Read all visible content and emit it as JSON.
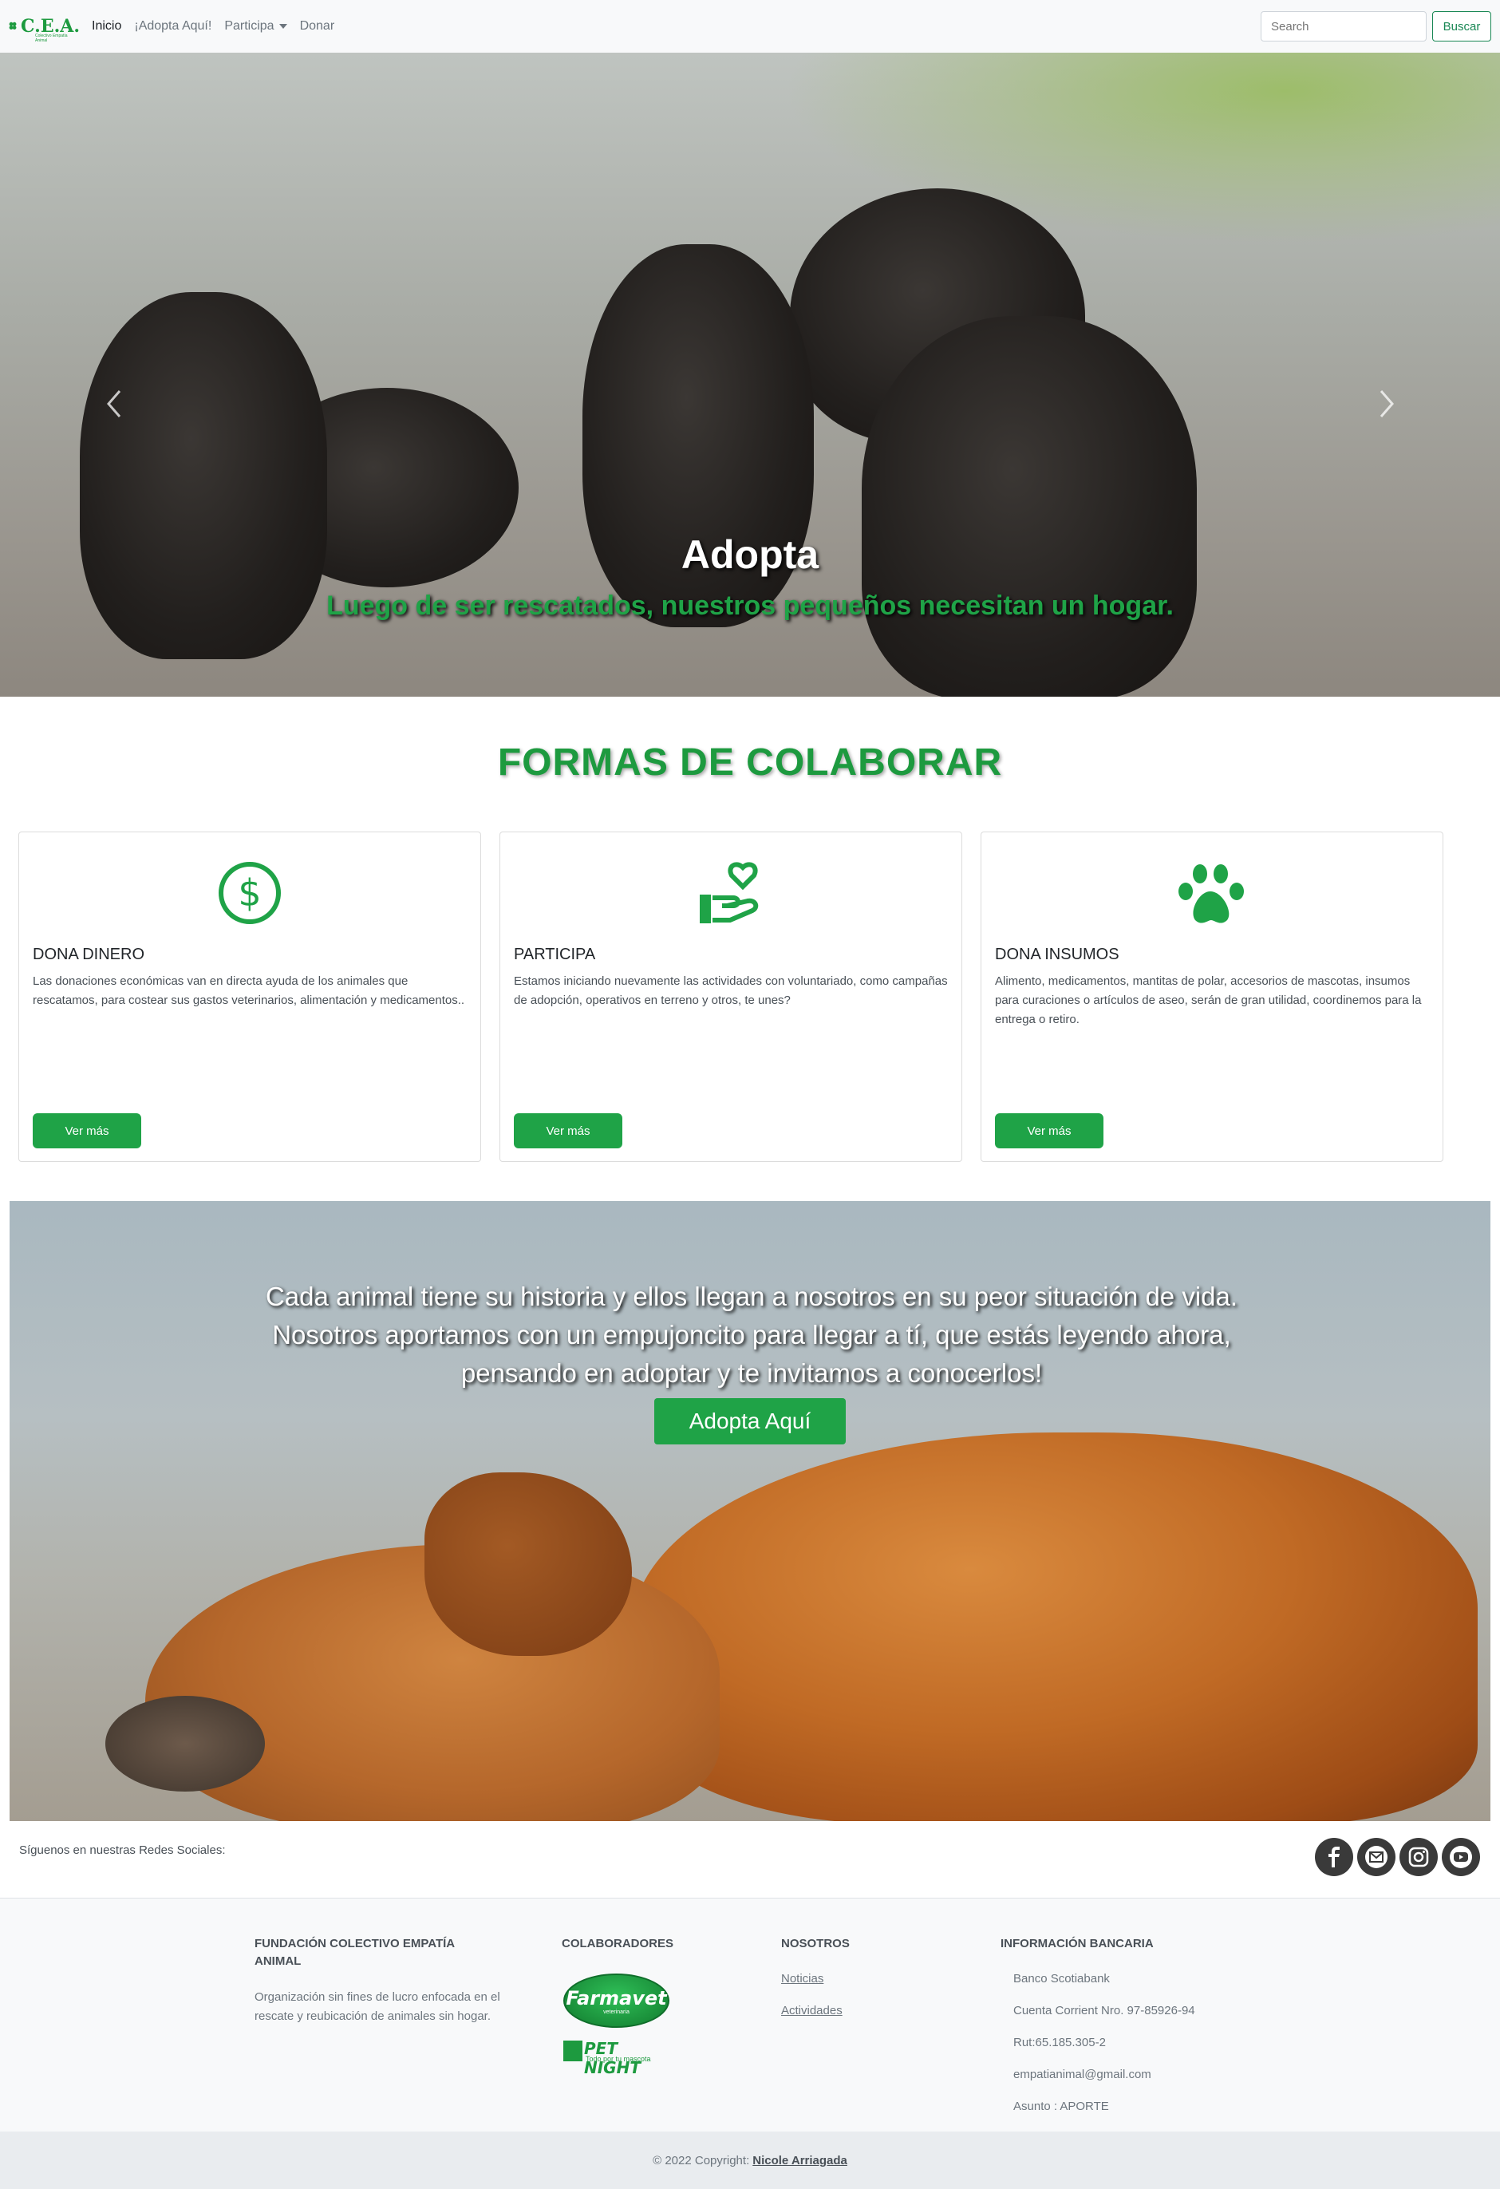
{
  "nav": {
    "logo_text": "C.E.A.",
    "logo_sub": "Colectivo Empatía Animal",
    "links": [
      "Inicio",
      "¡Adopta Aquí!",
      "Participa",
      "Donar"
    ],
    "search_placeholder": "Search",
    "search_button": "Buscar"
  },
  "hero": {
    "title": "Adopta",
    "subtitle": "Luego de ser rescatados, nuestros pequeños necesitan un hogar.",
    "prev_icon": "chevron-left-icon",
    "next_icon": "chevron-right-icon",
    "slides": 3,
    "active_slide": 1
  },
  "section": {
    "title": "FORMAS DE COLABORAR"
  },
  "cards": [
    {
      "icon": "dollar-circle-icon",
      "title": "DONA DINERO",
      "text": "Las donaciones económicas van en directa ayuda de los animales que rescatamos, para costear sus gastos veterinarios, alimentación y medicamentos..",
      "button": "Ver más"
    },
    {
      "icon": "hand-heart-icon",
      "title": "PARTICIPA",
      "text": "Estamos iniciando nuevamente las actividades con voluntariado, como campañas de adopción, operativos en terreno y otros, te unes?",
      "button": "Ver más"
    },
    {
      "icon": "paw-icon",
      "title": "DONA INSUMOS",
      "text": "Alimento, medicamentos, mantitas de polar, accesorios de mascotas, insumos para curaciones o artículos de aseo, serán de gran utilidad, coordinemos para la entrega o retiro.",
      "button": "Ver más"
    }
  ],
  "banner": {
    "text": "Cada animal tiene su historia y ellos llegan a nosotros en su peor situación de vida. Nosotros aportamos con un empujoncito para llegar a tí, que estás leyendo ahora, pensando en adoptar y te invitamos a conocerlos!",
    "button": "Adopta Aquí"
  },
  "social": {
    "label": "Síguenos en nuestras Redes Sociales:",
    "icons": [
      "facebook-icon",
      "email-icon",
      "instagram-icon",
      "youtube-icon"
    ]
  },
  "footer": {
    "org_title": "FUNDACIÓN COLECTIVO EMPATÍA ANIMAL",
    "org_text": "Organización sin fines de lucro enfocada en el rescate y reubicación de animales sin hogar.",
    "collab_title": "COLABORADORES",
    "collab_1": "Farmavet",
    "collab_1_sub": "veterinaria",
    "collab_2": "PET NIGHT",
    "collab_2_sub": "Todo por tu mascota",
    "about_title": "NOSOTROS",
    "about_links": [
      "Noticias",
      "Actividades"
    ],
    "bank_title": "INFORMACIÓN BANCARIA",
    "bank_lines": [
      "Banco Scotiabank",
      "Cuenta Corrient Nro. 97-85926-94",
      "Rut:65.185.305-2",
      "empatianimal@gmail.com",
      "Asunto : APORTE"
    ]
  },
  "copyright": {
    "text": "© 2022 Copyright:",
    "author": "Nicole Arriagada"
  },
  "colors": {
    "brand_green": "#1fa347",
    "navbar_bg": "#f8f9fa",
    "footer_bg": "#f8f9fa",
    "copyright_bg": "#e9ecef"
  }
}
